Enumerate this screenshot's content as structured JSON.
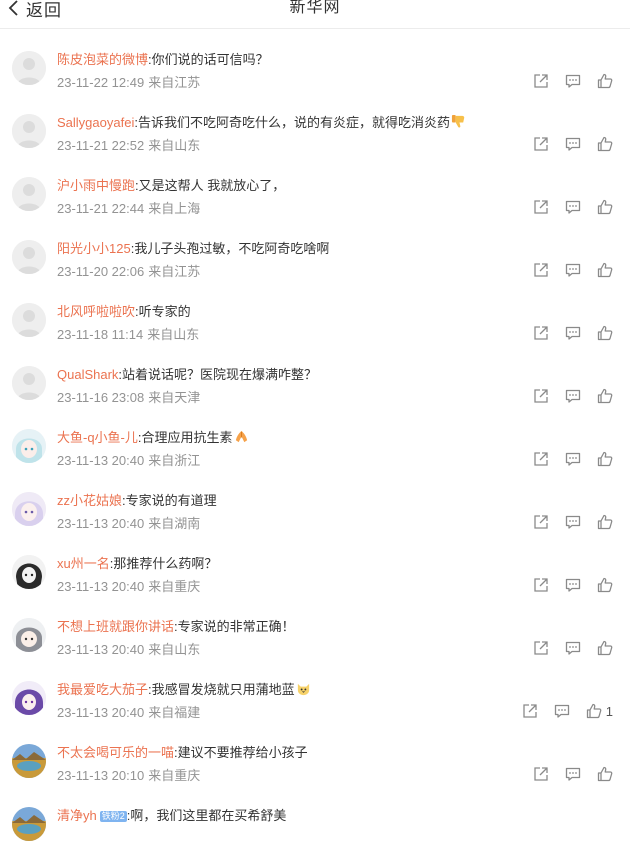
{
  "header": {
    "back_label": "返回",
    "title": "新华网"
  },
  "comments": [
    {
      "user": "陈皮泡菜的微博",
      "text": ":你们说的话可信吗？",
      "time": "23-11-22 12:49",
      "location": "来自江苏",
      "avatar": "default",
      "emoji": "",
      "likes": ""
    },
    {
      "user": "Sallygaoyafei",
      "text": ":告诉我们不吃阿奇吃什么，说的有炎症，就得吃消炎药",
      "time": "23-11-21 22:52",
      "location": "来自山东",
      "avatar": "default",
      "emoji": "thumbs-down",
      "likes": ""
    },
    {
      "user": "沪小雨中慢跑",
      "text": ":又是这帮人 我就放心了，",
      "time": "23-11-21 22:44",
      "location": "来自上海",
      "avatar": "default",
      "emoji": "",
      "likes": ""
    },
    {
      "user": "阳光小小125",
      "text": ":我儿子头孢过敏，不吃阿奇吃啥啊",
      "time": "23-11-20 22:06",
      "location": "来自江苏",
      "avatar": "default",
      "emoji": "",
      "likes": ""
    },
    {
      "user": "北风呼啦啦吹",
      "text": ":听专家的",
      "time": "23-11-18 11:14",
      "location": "来自山东",
      "avatar": "default",
      "emoji": "",
      "likes": ""
    },
    {
      "user": "QualShark",
      "text": ":站着说话呢？医院现在爆满咋整？",
      "time": "23-11-16 23:08",
      "location": "来自天津",
      "avatar": "default",
      "emoji": "",
      "likes": ""
    },
    {
      "user": "大鱼-q小鱼-儿",
      "text": ":合理应用抗生素",
      "time": "23-11-13 20:40",
      "location": "来自浙江",
      "avatar": "anime-blue",
      "emoji": "pray",
      "likes": ""
    },
    {
      "user": "zz小花姑娘",
      "text": ":专家说的有道理",
      "time": "23-11-13 20:40",
      "location": "来自湖南",
      "avatar": "anime-lilac",
      "emoji": "",
      "likes": ""
    },
    {
      "user": "xu州一名",
      "text": ":那推荐什么药啊？",
      "time": "23-11-13 20:40",
      "location": "来自重庆",
      "avatar": "anime-dark",
      "emoji": "",
      "likes": ""
    },
    {
      "user": "不想上班就跟你讲话",
      "text": ":专家说的非常正确！",
      "time": "23-11-13 20:40",
      "location": "来自山东",
      "avatar": "anime-grey",
      "emoji": "",
      "likes": ""
    },
    {
      "user": "我最爱吃大茄子",
      "text": ":我感冒发烧就只用蒲地蓝",
      "time": "23-11-13 20:40",
      "location": "来自福建",
      "avatar": "anime-purple",
      "emoji": "cat-face",
      "likes": "1"
    },
    {
      "user": "不太会喝可乐的一喵",
      "text": ":建议不要推荐给小孩子",
      "time": "23-11-13 20:10",
      "location": "来自重庆",
      "avatar": "landscape",
      "emoji": "",
      "likes": ""
    },
    {
      "user": "清净yh",
      "text": ":啊，我们这里都在买希舒美",
      "time": "",
      "location": "",
      "avatar": "landscape",
      "emoji": "",
      "likes": "",
      "badge": "铁粉2"
    }
  ],
  "colors": {
    "username": "#eb7350",
    "meta": "#939393",
    "icon": "#8a8a8a"
  }
}
